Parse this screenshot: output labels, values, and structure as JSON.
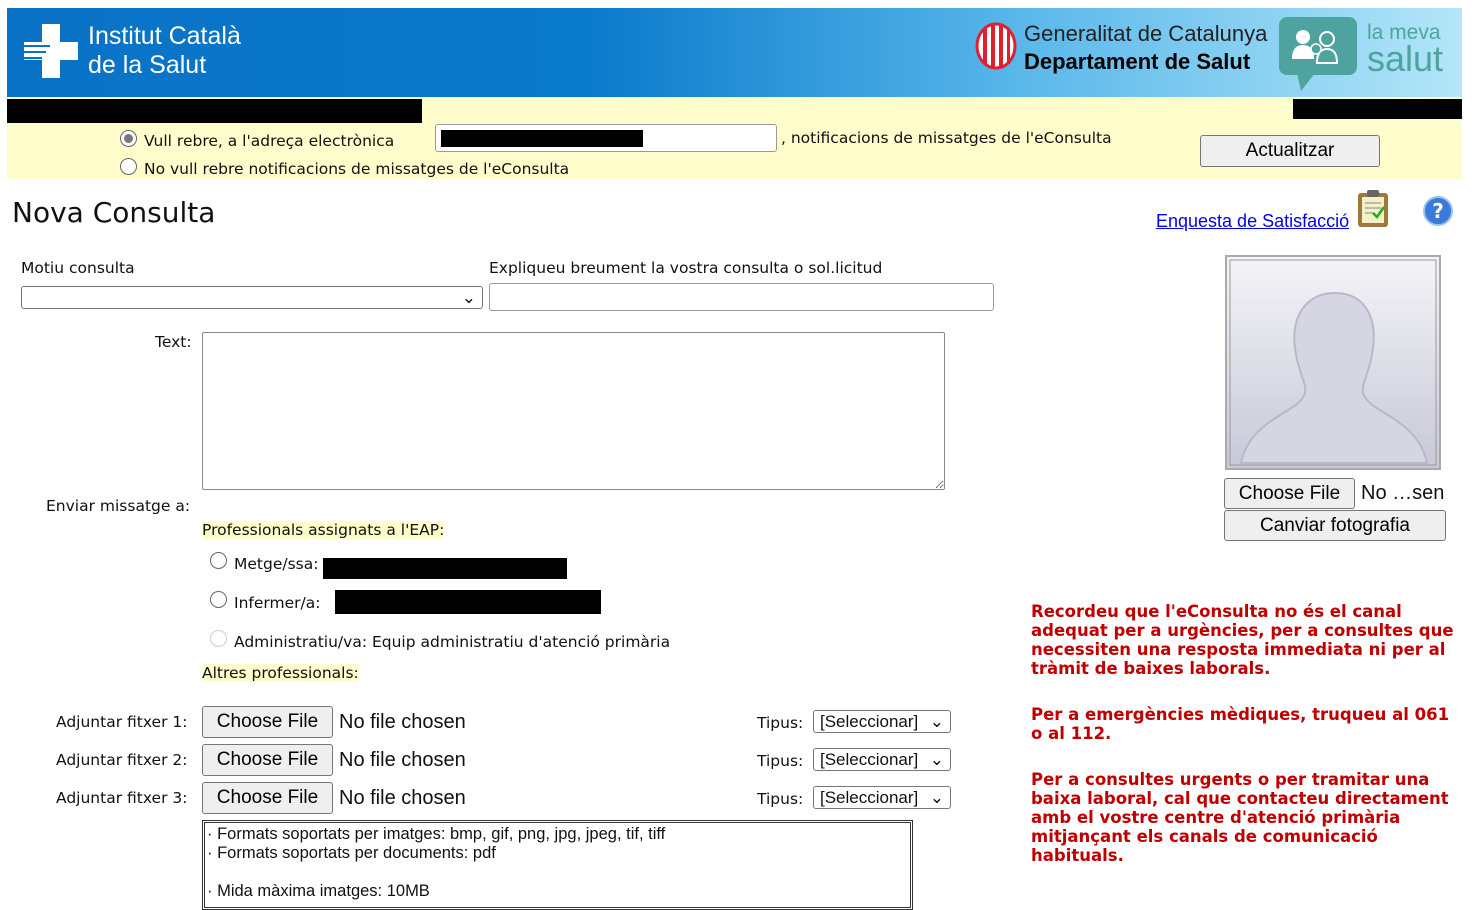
{
  "header": {
    "ics_line1": "Institut Català",
    "ics_line2": "de la Salut",
    "gen_line1": "Generalitat de Catalunya",
    "gen_line2": "Departament de Salut",
    "lms_line1": "la meva",
    "lms_line2": "salut"
  },
  "notifications": {
    "option_yes": "Vull rebre, a l'adreça electrònica",
    "option_yes_suffix": ", notificacions de missatges de l'eConsulta",
    "option_no": "No vull rebre notificacions de missatges de l'eConsulta",
    "selected": "yes",
    "update_button": "Actualitzar"
  },
  "page": {
    "title": "Nova Consulta",
    "survey_link": "Enquesta de Satisfacció"
  },
  "form": {
    "motiu_label": "Motiu consulta",
    "motiu_value": "",
    "explain_label": "Expliqueu breument la vostra consulta o sol.licitud",
    "explain_value": "",
    "text_label": "Text:",
    "text_value": "",
    "send_to_label": "Enviar missatge a:",
    "assigned_heading": "Professionals assignats a l'EAP:",
    "recipients": [
      {
        "label": "Metge/ssa:"
      },
      {
        "label": "Infermer/a:"
      },
      {
        "label": "Administratiu/va: Equip administratiu d'atenció primària",
        "disabled": true
      }
    ],
    "others_heading": "Altres professionals:",
    "attachments": [
      {
        "label": "Adjuntar fitxer 1:",
        "button": "Choose File",
        "status": "No file chosen",
        "type_label": "Tipus:",
        "type_value": "[Seleccionar]"
      },
      {
        "label": "Adjuntar fitxer 2:",
        "button": "Choose File",
        "status": "No file chosen",
        "type_label": "Tipus:",
        "type_value": "[Seleccionar]"
      },
      {
        "label": "Adjuntar fitxer 3:",
        "button": "Choose File",
        "status": "No file chosen",
        "type_label": "Tipus:",
        "type_value": "[Seleccionar]"
      }
    ],
    "info": [
      "· Formats soportats per imatges: bmp, gif, png, jpg, jpeg, tif, tiff",
      "· Formats soportats per documents: pdf",
      "",
      "· Mida màxima imatges: 10MB"
    ]
  },
  "photo": {
    "choose_button": "Choose File",
    "status": "No …sen",
    "change_button": "Canviar fotografia"
  },
  "warnings": [
    "Recordeu que l'eConsulta no és el canal adequat per a urgències, per a consultes que necessiten una resposta immediata ni per al tràmit de baixes laborals.",
    "Per a emergències mèdiques, truqueu al 061 o al 112.",
    "Per a consultes urgents o per tramitar una baixa laboral, cal que contacteu directament amb el vostre centre d'atenció primària mitjançant els canals de comunicació habituals."
  ],
  "colors": {
    "header_blue": "#0a72c6",
    "notice_bg": "#fefdcb",
    "warning_red": "#c00000",
    "link_blue": "#0000ee"
  }
}
